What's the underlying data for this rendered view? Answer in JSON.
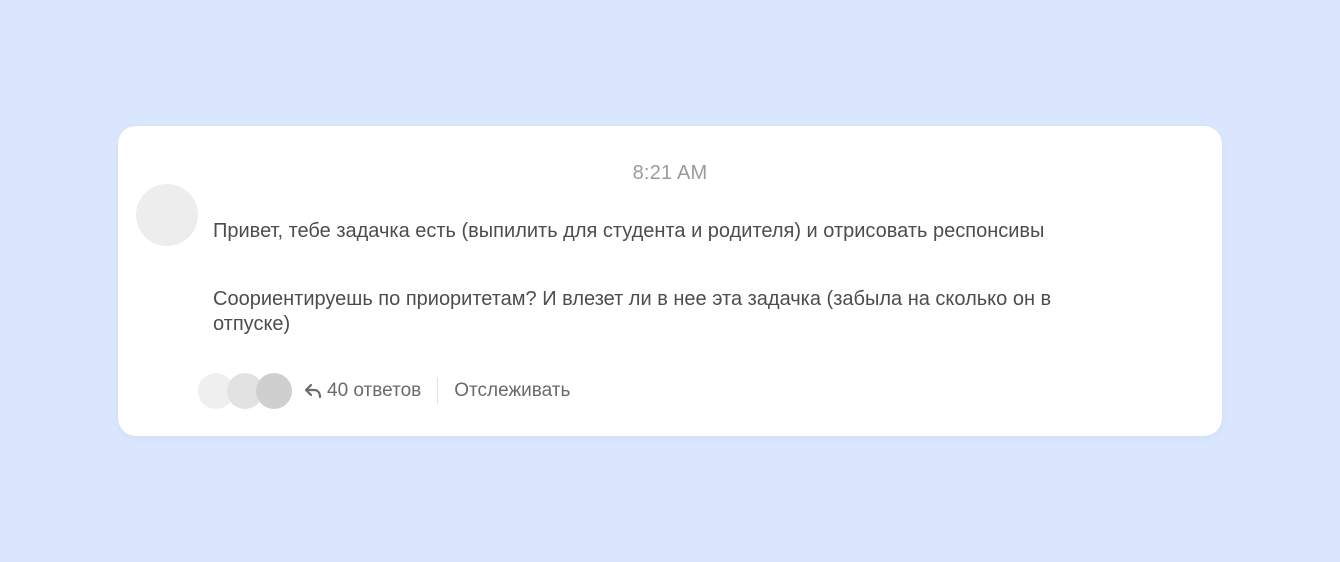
{
  "message": {
    "timestamp": "8:21 AM",
    "paragraphs": [
      "Привет, тебе задачка есть (выпилить для студента и родителя) и отрисовать респонсивы",
      "Соориентируешь по приоритетам? И влезет ли в нее эта задачка (забыла на сколько он в отпуске)"
    ]
  },
  "thread": {
    "reply_icon": "reply-arrow-icon",
    "replies_label": "40 ответов",
    "follow_label": "Отслеживать"
  },
  "colors": {
    "background": "#d9e6fd",
    "card": "#ffffff",
    "text": "#4d4d4d",
    "muted_text": "#9b9b9b"
  }
}
